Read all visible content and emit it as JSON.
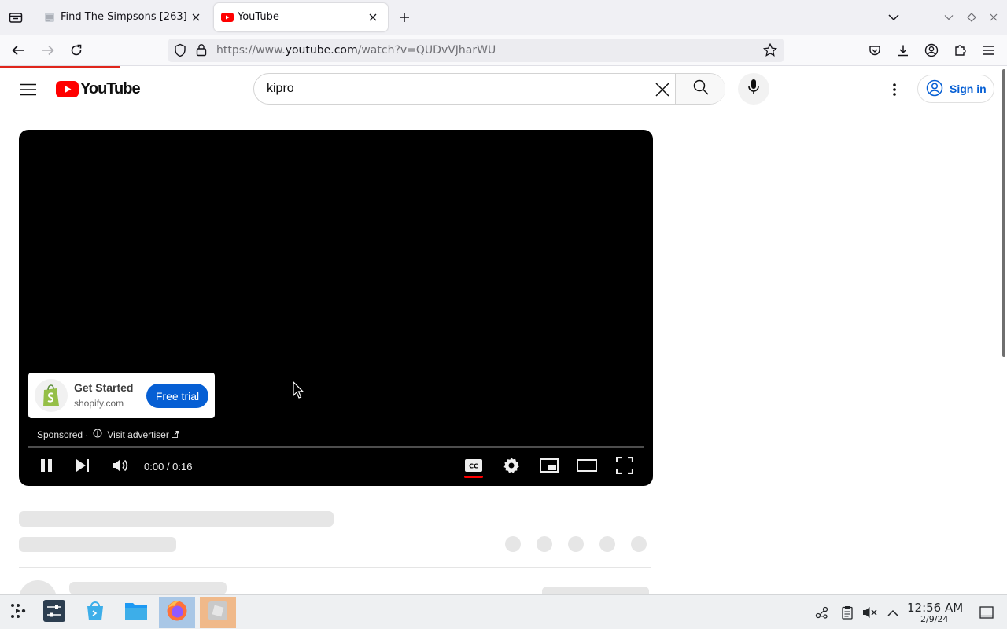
{
  "browser": {
    "tabs": [
      {
        "title": "Find The Simpsons [263] -",
        "active": false,
        "favicon": "page-icon"
      },
      {
        "title": "YouTube",
        "active": true,
        "favicon": "youtube-icon"
      }
    ],
    "url_prefix": "https://www.",
    "url_host": "youtube.com",
    "url_path": "/watch?v=QUDvVJharWU"
  },
  "youtube": {
    "logo_text": "YouTube",
    "search_value": "kipro",
    "sign_in_label": "Sign in",
    "accent_red": "#ff0000",
    "link_blue": "#065fd4"
  },
  "player": {
    "ad": {
      "title": "Get Started",
      "domain": "shopify.com",
      "cta_label": "Free trial",
      "sponsored_label": "Sponsored ·",
      "visit_label": "Visit advertiser"
    },
    "time_current": "0:00",
    "time_separator": " / ",
    "time_total": "0:16",
    "progress_fraction": 0.0
  },
  "taskbar": {
    "time": "12:56 AM",
    "date": "2/9/24"
  }
}
